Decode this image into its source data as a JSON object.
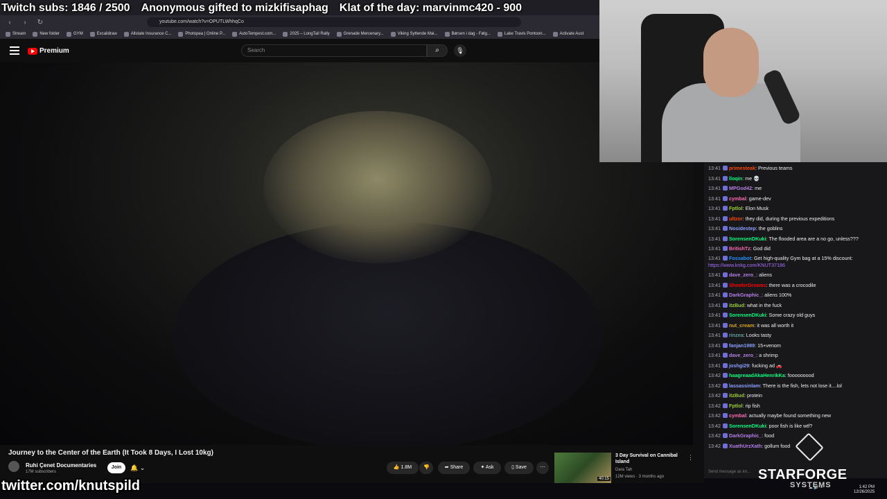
{
  "overlay": {
    "subs": "Twitch subs: 1846 / 2500",
    "gift": "Anonymous gifted to mizkifisaphag",
    "klat": "Klat of the day: marvinmc420 - 900",
    "twitter": "twitter.com/knutspild"
  },
  "browser": {
    "url": "youtube.com/watch?v=OPUTLWhhqCo",
    "bookmarks": [
      "Stream",
      "New folder",
      "GYM",
      "Excalidraw",
      "Allstate Insurance C...",
      "Photopea | Online P...",
      "AutoTempest.com...",
      "2025 – LongTail Rally",
      "Grenade Mercenary...",
      "Viking Syttende Mai...",
      "Børsen i dag - Følg...",
      "Lake Travis Pontoon...",
      "Activate Aust"
    ]
  },
  "youtube": {
    "logo": "Premium",
    "search_placeholder": "Search",
    "video_title": "Journey to the Center of the Earth (It Took 8 Days, I Lost 10kg)",
    "channel": "Ruhi Çenet Documentaries",
    "subscribers": "17M subscribers",
    "join_label": "Join",
    "likes": "1.8M",
    "share_label": "Share",
    "ask_label": "Ask",
    "save_label": "Save",
    "recommended": {
      "title": "3 Day Survival on Cannibal Island",
      "channel": "Dara Tah",
      "meta": "12M views · 3 months ago",
      "duration": "40:15"
    }
  },
  "chat": {
    "messages": [
      {
        "ts": "13:41",
        "user": "primesteak",
        "color": "#ff4500",
        "text": "Previous teams"
      },
      {
        "ts": "13:41",
        "user": "lloqin",
        "color": "#00ff7f",
        "text": "me 💀"
      },
      {
        "ts": "13:41",
        "user": "MPGod42",
        "color": "#b57ee5",
        "text": "me"
      },
      {
        "ts": "13:41",
        "user": "cymbal",
        "color": "#ff69b4",
        "text": "game-dev"
      },
      {
        "ts": "13:41",
        "user": "Fptlol",
        "color": "#9acd32",
        "text": "Elon Musk"
      },
      {
        "ts": "13:41",
        "user": "ultzor",
        "color": "#ff4500",
        "text": "they did, during the previous expeditions"
      },
      {
        "ts": "13:41",
        "user": "Nosidestep",
        "color": "#8a9fff",
        "text": "the goblins"
      },
      {
        "ts": "13:41",
        "user": "SorensenDKuki",
        "color": "#00ff7f",
        "text": "The flooded area are a no go, unless???",
        "wrap": true
      },
      {
        "ts": "13:41",
        "user": "BritishTz",
        "color": "#ff69b4",
        "text": "God did"
      },
      {
        "ts": "13:41",
        "user": "Fossabot",
        "color": "#1e90ff",
        "text": "Get high-quality Gym bag at a 15% discount: ",
        "link": "https://www.knkg.com/KNUT37186",
        "wrap": true
      },
      {
        "ts": "13:41",
        "user": "dave_zero_",
        "color": "#b57ee5",
        "text": "aliens"
      },
      {
        "ts": "13:41",
        "user": "ShooferDreams",
        "color": "#ff0000",
        "text": "there was a crocodile"
      },
      {
        "ts": "13:41",
        "user": "DarkGraphic_",
        "color": "#b57ee5",
        "text": "aliens 100%"
      },
      {
        "ts": "13:41",
        "user": "itzBud",
        "color": "#9acd32",
        "text": "what in the fuck"
      },
      {
        "ts": "13:41",
        "user": "SorensenDKuki",
        "color": "#00ff7f",
        "text": "Some crazy old guys"
      },
      {
        "ts": "13:41",
        "user": "nut_cream",
        "color": "#daa520",
        "text": "it was all worth it"
      },
      {
        "ts": "13:41",
        "user": "rinzea",
        "color": "#5f9ea0",
        "text": "Looks tasty"
      },
      {
        "ts": "13:41",
        "user": "fanjan1989",
        "color": "#8a9fff",
        "text": "15+venom"
      },
      {
        "ts": "13:41",
        "user": "dave_zero_",
        "color": "#b57ee5",
        "text": "a shrimp"
      },
      {
        "ts": "13:41",
        "user": "joshgi29",
        "color": "#8a9fff",
        "text": "fucking ad 🚗"
      },
      {
        "ts": "13:42",
        "user": "haagreaadAkaHenrikKa",
        "color": "#00ff7f",
        "text": "fooooooood"
      },
      {
        "ts": "13:42",
        "user": "lassassinlam",
        "color": "#8a9fff",
        "text": "There is the fish, lets not lose it....lol"
      },
      {
        "ts": "13:42",
        "user": "itzBud",
        "color": "#9acd32",
        "text": "protein"
      },
      {
        "ts": "13:42",
        "user": "Fptlol",
        "color": "#9acd32",
        "text": "rip fish"
      },
      {
        "ts": "13:42",
        "user": "cymbal",
        "color": "#ff69b4",
        "text": "actually maybe found something new"
      },
      {
        "ts": "13:42",
        "user": "SorensenDKuki",
        "color": "#00ff7f",
        "text": "poor fish is like wtf?"
      },
      {
        "ts": "13:42",
        "user": "DarkGraphic_",
        "color": "#b57ee5",
        "text": "food"
      },
      {
        "ts": "13:42",
        "user": "XuathUrzXath",
        "color": "#b57ee5",
        "text": "gollum food"
      }
    ],
    "input_placeholder": "Send message as kn..."
  },
  "branding": {
    "name": "STARFORGE",
    "sub": "SYSTEMS"
  },
  "clock": {
    "time": "1:42 PM",
    "date": "12/26/2025"
  }
}
